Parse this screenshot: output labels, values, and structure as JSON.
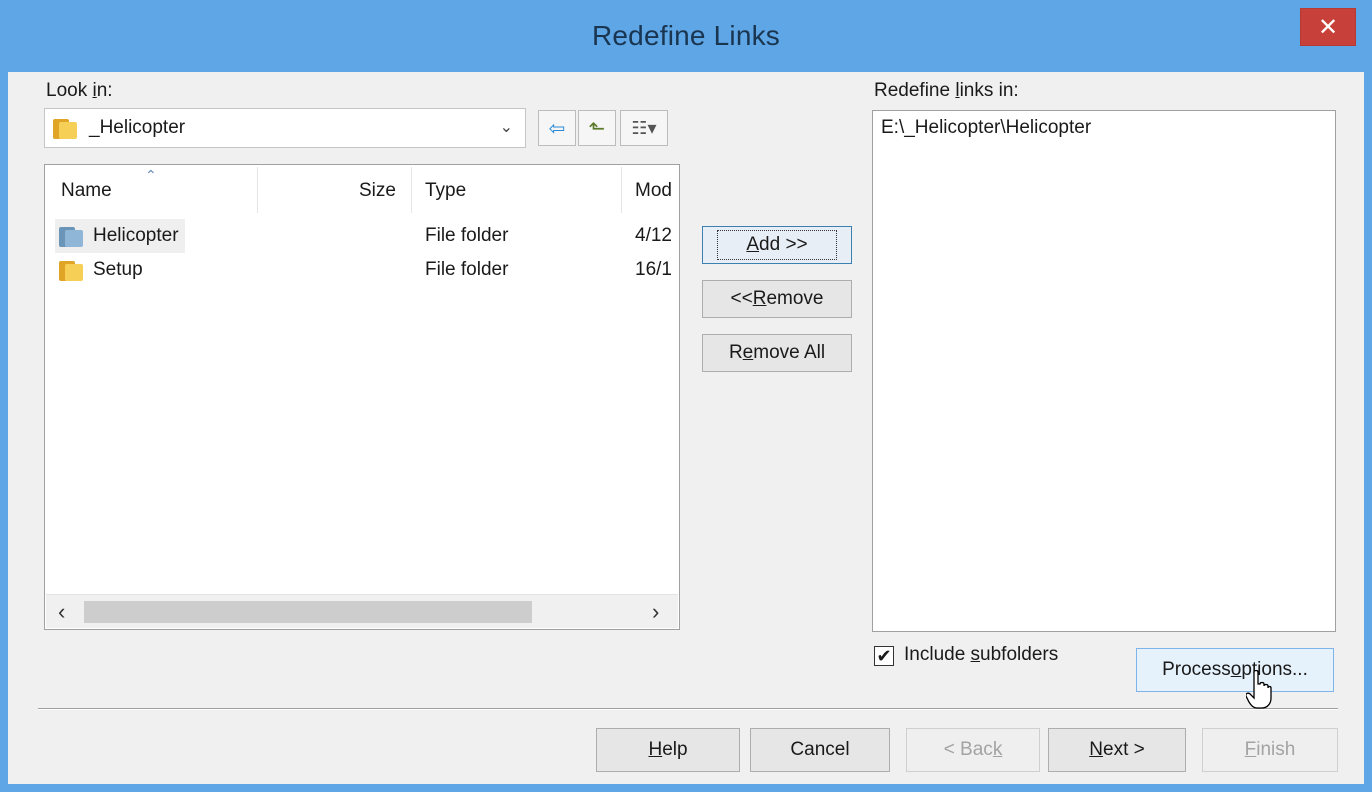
{
  "window": {
    "title": "Redefine Links",
    "close_glyph": "✕"
  },
  "look_in": {
    "label_pre": "Look ",
    "label_accel": "i",
    "label_post": "n:",
    "current_folder": "_Helicopter",
    "dropdown_glyph": "⌄"
  },
  "toolbar": {
    "back_icon": "⇦",
    "up_icon": "⬑",
    "view_icon": "☷▾"
  },
  "file_list": {
    "columns": [
      "Name",
      "Size",
      "Type",
      "Mod"
    ],
    "sort_glyph": "⌃",
    "rows": [
      {
        "name": "Helicopter",
        "size": "",
        "type": "File folder",
        "modified": "4/12",
        "icon": "folder-blue-icon"
      },
      {
        "name": "Setup",
        "size": "",
        "type": "File folder",
        "modified": "16/1",
        "icon": "folder-yellow-icon"
      }
    ],
    "scroll_left": "‹",
    "scroll_right": "›"
  },
  "middle_buttons": {
    "add_accel": "A",
    "add_rest": "dd >>",
    "remove_pre": "<< ",
    "remove_accel": "R",
    "remove_rest": "emove",
    "remove_all_pre": "R",
    "remove_all_accel": "e",
    "remove_all_rest": "move All"
  },
  "redefine": {
    "label_pre": "Redefine ",
    "label_accel": "l",
    "label_post": "inks in:",
    "entries": [
      "E:\\_Helicopter\\Helicopter"
    ]
  },
  "include_subfolders": {
    "checked": true,
    "check_glyph": "✔",
    "label_pre": "Include ",
    "label_accel": "s",
    "label_post": "ubfolders"
  },
  "process_options": {
    "label_pre": "Process ",
    "label_accel": "o",
    "label_post": "ptions..."
  },
  "footer": {
    "help_accel": "H",
    "help_rest": "elp",
    "cancel": "Cancel",
    "back_pre": "< Bac",
    "back_accel": "k",
    "next_accel": "N",
    "next_rest": "ext >",
    "finish_accel": "F",
    "finish_rest": "inish"
  }
}
